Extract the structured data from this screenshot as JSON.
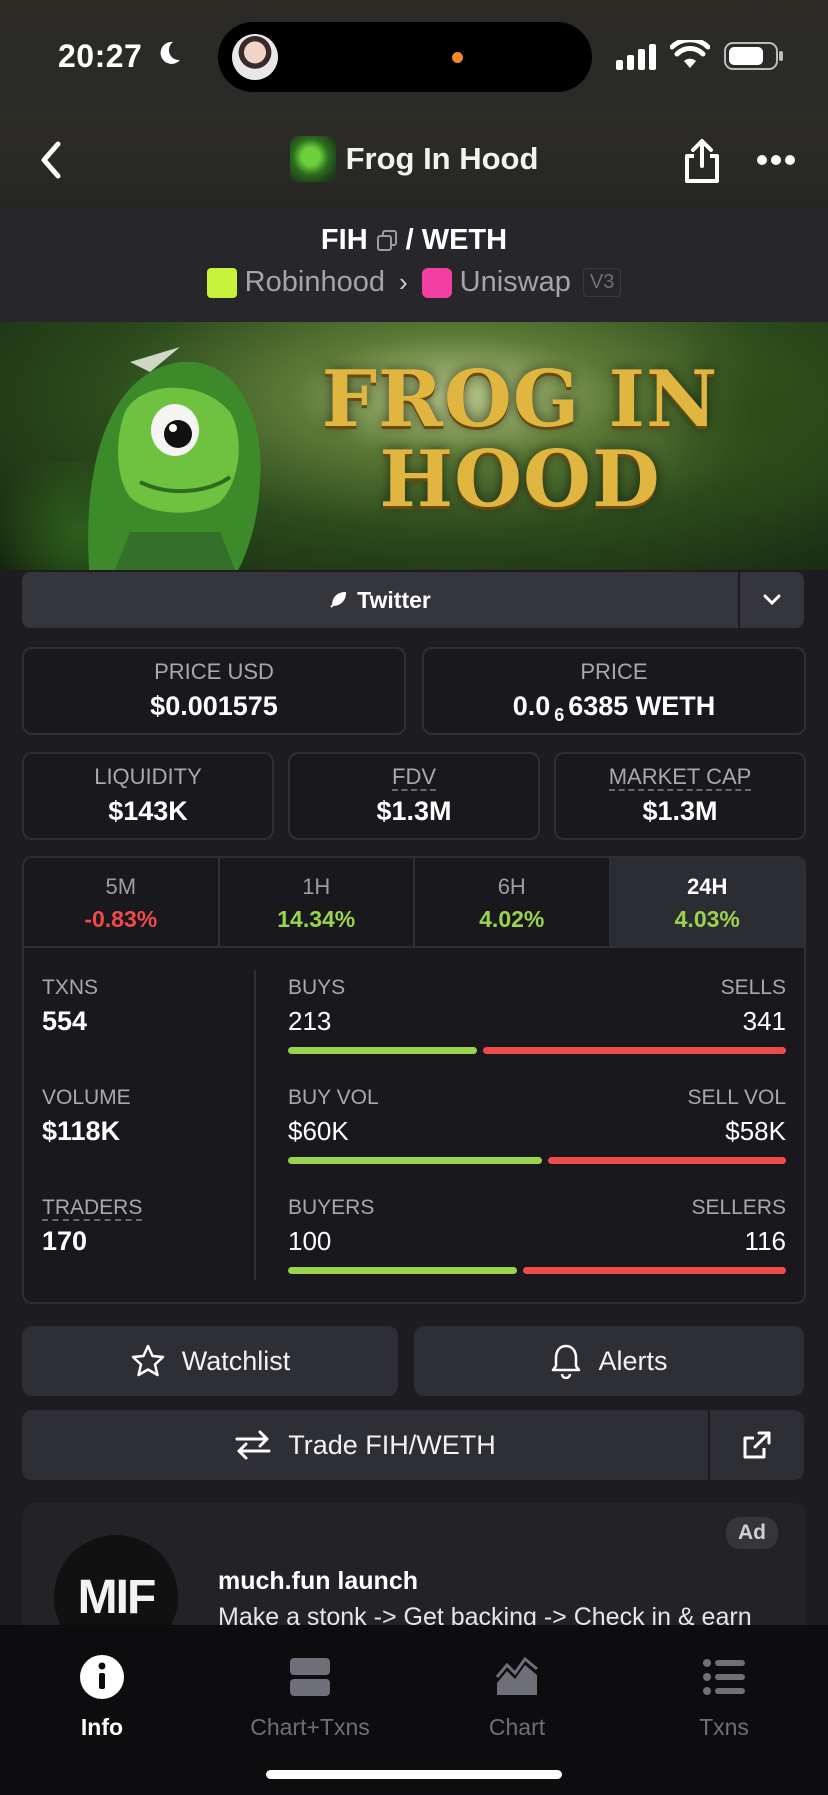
{
  "status": {
    "time": "20:27"
  },
  "header": {
    "title": "Frog In Hood"
  },
  "pair": {
    "base": "FIH",
    "separator": "/",
    "quote": "WETH",
    "chain": "Robinhood",
    "dex": "Uniswap",
    "version": "V3"
  },
  "banner": {
    "line1": "FROG IN",
    "line2": "HOOD"
  },
  "links": {
    "twitter_label": "Twitter"
  },
  "prices": {
    "price_usd_label": "PRICE USD",
    "price_usd": "$0.001575",
    "price_label": "PRICE",
    "price_prefix": "0.0",
    "price_zeros": "6",
    "price_suffix": "6385 WETH"
  },
  "metrics": {
    "liquidity_label": "LIQUIDITY",
    "liquidity": "$143K",
    "fdv_label": "FDV",
    "fdv": "$1.3M",
    "mcap_label": "MARKET CAP",
    "mcap": "$1.3M"
  },
  "timeframes": [
    {
      "label": "5M",
      "change": "-0.83%",
      "dir": "neg"
    },
    {
      "label": "1H",
      "change": "14.34%",
      "dir": "pos"
    },
    {
      "label": "6H",
      "change": "4.02%",
      "dir": "pos"
    },
    {
      "label": "24H",
      "change": "4.03%",
      "dir": "pos",
      "active": true
    }
  ],
  "stats": {
    "txns_label": "TXNS",
    "txns": "554",
    "volume_label": "VOLUME",
    "volume": "$118K",
    "traders_label": "TRADERS",
    "traders": "170",
    "buys_label": "BUYS",
    "buys": "213",
    "sells_label": "SELLS",
    "sells": "341",
    "buy_vol_label": "BUY VOL",
    "buy_vol": "$60K",
    "sell_vol_label": "SELL VOL",
    "sell_vol": "$58K",
    "buyers_label": "BUYERS",
    "buyers": "100",
    "sellers_label": "SELLERS",
    "sellers": "116",
    "buys_share": 0.38,
    "buy_vol_share": 0.51,
    "buyers_share": 0.46
  },
  "actions": {
    "watchlist": "Watchlist",
    "alerts": "Alerts",
    "trade": "Trade FIH/WETH"
  },
  "ad": {
    "badge": "Ad",
    "logo_text": "MIF",
    "title": "much.fun launch",
    "desc": "Make a stonk -> Get backing -> Check in & earn"
  },
  "tabbar": {
    "info": "Info",
    "chart_txns": "Chart+Txns",
    "chart": "Chart",
    "txns": "Txns"
  },
  "colors": {
    "positive": "#9ad44b",
    "negative": "#f04b4b",
    "background": "#1c1c21"
  }
}
